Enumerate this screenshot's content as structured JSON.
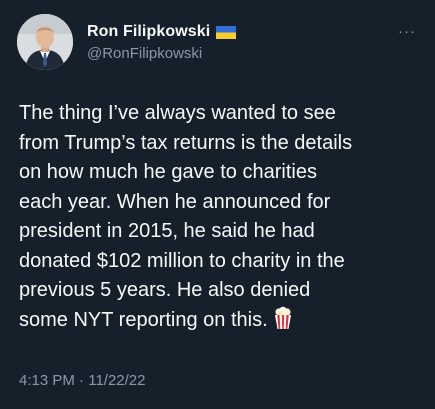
{
  "user": {
    "display_name": "Ron Filipkowski",
    "handle": "@RonFilipkowski",
    "flag_icon": "ukraine-flag-icon"
  },
  "tweet": {
    "lines": [
      "The thing I’ve always wanted to see",
      "from Trump’s tax returns is the details",
      "on how much he gave to charities",
      "each year. When he announced for",
      "president in 2015, he said he had",
      "donated $102 million to charity in the",
      "previous 5 years. He also denied",
      "some NYT reporting on this."
    ],
    "emoji": "popcorn-icon"
  },
  "meta": {
    "time": "4:13 PM",
    "separator": " · ",
    "date": "11/22/22"
  },
  "more_label": "···",
  "colors": {
    "background": "#15202b",
    "primary_text": "#f7f9f9",
    "secondary_text": "#8b98a5"
  }
}
